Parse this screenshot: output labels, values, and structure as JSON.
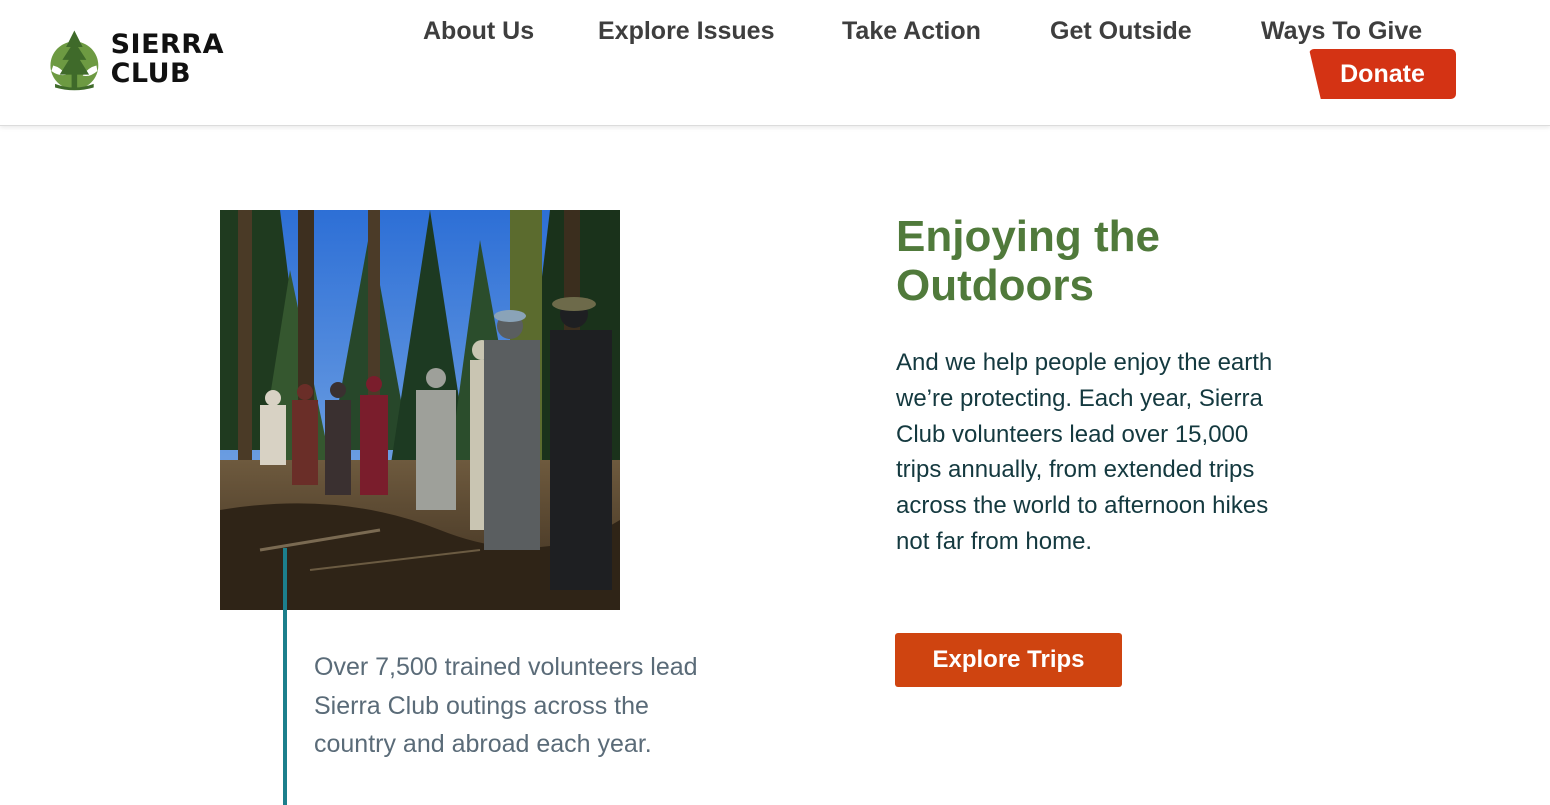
{
  "logo": {
    "line1": "SIERRA",
    "line2": "CLUB",
    "icon": "sierra-club-tree-logo"
  },
  "nav": {
    "items": [
      {
        "label": "About Us"
      },
      {
        "label": "Explore Issues"
      },
      {
        "label": "Take Action"
      },
      {
        "label": "Get Outside"
      },
      {
        "label": "Ways To Give"
      }
    ],
    "donate_label": "Donate"
  },
  "main": {
    "caption": "Over 7,500 trained volunteers lead Sierra Club outings across the country and abroad each year.",
    "title": "Enjoying the Outdoors",
    "body": "And we help people enjoy the earth we’re protecting. Each year, Sierra Club volunteers lead over 15,000 trips annually, from extended trips across the world to afternoon hikes not far from home.",
    "cta_label": "Explore Trips"
  },
  "colors": {
    "brand_green": "#507a3b",
    "donate_red": "#d43314",
    "cta_orange": "#cf4410",
    "accent_teal": "#1c7f8c",
    "body_text": "#14393f",
    "caption_text": "#5a6b78"
  }
}
